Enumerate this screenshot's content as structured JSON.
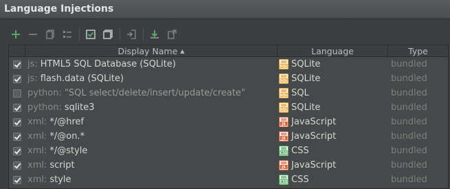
{
  "title": "Language Injections",
  "toolbar": {
    "buttons": [
      {
        "name": "add-button",
        "icon": "plus-icon"
      },
      {
        "name": "remove-button",
        "icon": "minus-icon"
      },
      {
        "name": "copy-button",
        "icon": "copy-icon"
      },
      {
        "name": "edit-button",
        "icon": "edit-list-icon"
      },
      {
        "name": "enable-selected-button",
        "icon": "checked-box-icon"
      },
      {
        "name": "disable-selected-button",
        "icon": "unchecked-box-icon"
      },
      {
        "name": "import-button",
        "icon": "import-icon"
      },
      {
        "name": "export-button",
        "icon": "export-icon"
      },
      {
        "name": "move-button",
        "icon": "move-icon"
      }
    ]
  },
  "table": {
    "columns": {
      "display_name": "Display Name",
      "language": "Language",
      "type": "Type"
    },
    "rows": [
      {
        "checked": true,
        "prefix": "js:",
        "name": "HTML5 SQL Database (SQLite)",
        "language": "SQLite",
        "lang_icon": "sql-icon",
        "type": "bundled"
      },
      {
        "checked": true,
        "prefix": "js:",
        "name": "flash.data (SQLite)",
        "language": "SQLite",
        "lang_icon": "sql-icon",
        "type": "bundled"
      },
      {
        "checked": false,
        "prefix": "python:",
        "name": "\"SQL select/delete/insert/update/create\"",
        "language": "SQL",
        "lang_icon": "sql-icon",
        "type": "bundled"
      },
      {
        "checked": true,
        "prefix": "python:",
        "name": "sqlite3",
        "language": "SQLite",
        "lang_icon": "sql-icon",
        "type": "bundled"
      },
      {
        "checked": true,
        "prefix": "xml:",
        "name": "*/@href",
        "language": "JavaScript",
        "lang_icon": "js-icon",
        "type": "bundled"
      },
      {
        "checked": true,
        "prefix": "xml:",
        "name": "*/@on.*",
        "language": "JavaScript",
        "lang_icon": "js-icon",
        "type": "bundled"
      },
      {
        "checked": true,
        "prefix": "xml:",
        "name": "*/@style",
        "language": "CSS",
        "lang_icon": "css-icon",
        "type": "bundled"
      },
      {
        "checked": true,
        "prefix": "xml:",
        "name": "script",
        "language": "JavaScript",
        "lang_icon": "js-icon",
        "type": "bundled"
      },
      {
        "checked": true,
        "prefix": "xml:",
        "name": "style",
        "language": "CSS",
        "lang_icon": "css-icon",
        "type": "bundled"
      }
    ]
  },
  "colors": {
    "background": "#3c3f41",
    "table_background": "#45494a",
    "add_green": "#59a869",
    "sql_icon": "#e8a33c",
    "js_icon": "#d0623d",
    "css_icon": "#4aa35b"
  }
}
